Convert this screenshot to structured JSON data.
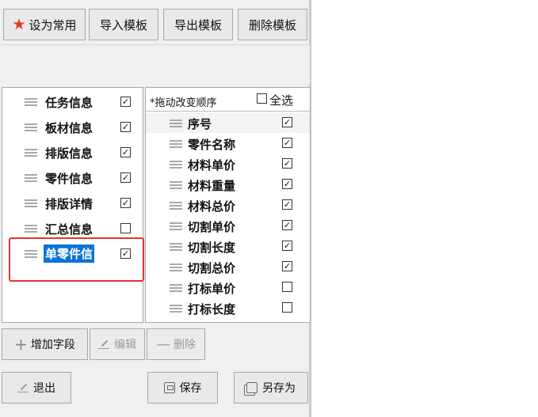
{
  "toolbar": {
    "set_common": "设为常用",
    "import_template": "导入模板",
    "export_template": "导出模板",
    "delete_template": "删除模板"
  },
  "categories": [
    {
      "label": "任务信息",
      "checked": true
    },
    {
      "label": "板材信息",
      "checked": true
    },
    {
      "label": "排版信息",
      "checked": true
    },
    {
      "label": "零件信息",
      "checked": true
    },
    {
      "label": "排版详情",
      "checked": true
    },
    {
      "label": "汇总信息",
      "checked": false
    },
    {
      "label": "单零件信",
      "checked": true,
      "selected": true
    }
  ],
  "fields_panel": {
    "drag_hint": "*拖动改变顺序",
    "select_all": "全选",
    "select_all_checked": false,
    "fields": [
      {
        "label": "序号",
        "checked": true
      },
      {
        "label": "零件名称",
        "checked": true
      },
      {
        "label": "材料单价",
        "checked": true
      },
      {
        "label": "材料重量",
        "checked": true
      },
      {
        "label": "材料总价",
        "checked": true
      },
      {
        "label": "切割单价",
        "checked": true
      },
      {
        "label": "切割长度",
        "checked": true
      },
      {
        "label": "切割总价",
        "checked": true
      },
      {
        "label": "打标单价",
        "checked": false
      },
      {
        "label": "打标长度",
        "checked": false
      }
    ]
  },
  "field_actions": {
    "add_field": "增加字段",
    "edit": "编辑",
    "delete": "删除"
  },
  "bottom": {
    "exit": "退出",
    "save": "保存",
    "save_as": "另存为"
  },
  "icons": {
    "star": "star-icon",
    "grip": "drag-handle-icon",
    "check": "checkbox-icon"
  },
  "colors": {
    "star": "#e53a19",
    "selection": "#0a73d9",
    "highlight_box": "#e8312f"
  }
}
